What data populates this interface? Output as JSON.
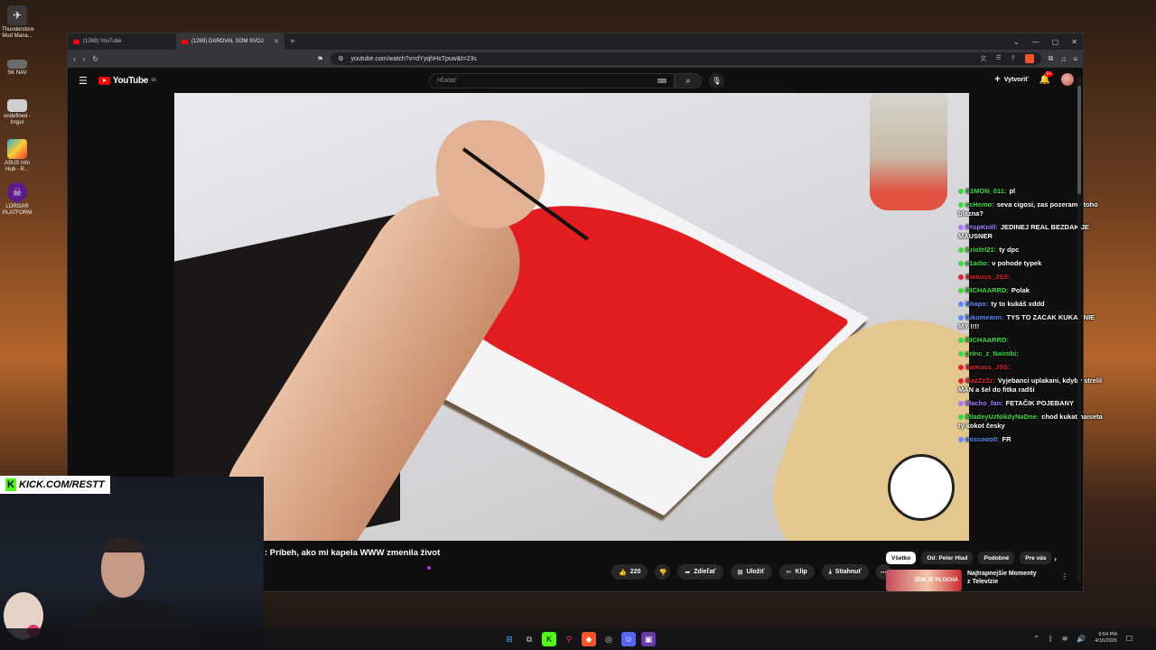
{
  "desktop": {
    "icons": [
      {
        "label": "Thunderstore Mod Mana...",
        "icon": "thunderstore-icon"
      },
      {
        "label": "SK NAV",
        "icon": "folder-icon"
      },
      {
        "label": "undefined - Imgur",
        "icon": "imgur-icon"
      },
      {
        "label": "ASUS Info Hub - R...",
        "icon": "asus-icon"
      },
      {
        "label": "LORGAR PLATFORM",
        "icon": "lorgar-icon"
      }
    ]
  },
  "browser": {
    "tabs": [
      {
        "title": "(1269) YouTube",
        "active": false
      },
      {
        "title": "(1269) DAROVAL SOM SVOJ",
        "active": true
      }
    ],
    "url": "youtube.com/watch?v=dYyqhHxTpuw&t=23s"
  },
  "youtube": {
    "logo_text": "YouTube",
    "logo_region": "SK",
    "search_placeholder": "Hľadať",
    "create_label": "Vytvoriť",
    "notif_count": "9+",
    "video_title": ": Príbeh, ako mi kapela WWW zmenila život",
    "actions": {
      "like_count": "220",
      "share": "Zdieľať",
      "save": "Uložiť",
      "clip": "Klip",
      "download": "Stiahnuť"
    },
    "chips": [
      "Všetko",
      "Od: Peter Hlad",
      "Podobné",
      "Pre vás"
    ],
    "recommended": {
      "thumb_text": "ZEM JE PLOCHÁ",
      "title": "Najtrapnejšie Momenty z Televízie"
    }
  },
  "chat": [
    {
      "user": "S1MON_011:",
      "msg": "pl",
      "color": "#3cdc3c"
    },
    {
      "user": "scHemo:",
      "msg": "seva cigosi, zas pozerame toho blazna?",
      "color": "#3cdc3c"
    },
    {
      "user": "PropKnill:",
      "msg": "JEDINEJ REAL BEZDAK JE MAUSNER",
      "color": "#a87cff"
    },
    {
      "user": "Kristel21:",
      "msg": "ty dpc",
      "color": "#3cdc3c"
    },
    {
      "user": "e1adio:",
      "msg": "v pohode typek",
      "color": "#3cdc3c"
    },
    {
      "user": "Samuss_JSS:",
      "msg": "",
      "color": "#e0262a"
    },
    {
      "user": "RICHAARRD:",
      "msg": "Polak",
      "color": "#3cdc3c"
    },
    {
      "user": "Shapo:",
      "msg": "ty to kukáš xddd",
      "color": "#5a8cff"
    },
    {
      "user": "fukumeann:",
      "msg": "TYS TO ZACAK KUKAT NIE MY !!!!",
      "color": "#5a8cff"
    },
    {
      "user": "RICHAARRD:",
      "msg": "",
      "color": "#3cdc3c"
    },
    {
      "user": "princ_z_Nairobi:",
      "msg": "",
      "color": "#3cdc3c"
    },
    {
      "user": "Samuss_JSS:",
      "msg": "",
      "color": "#e0262a"
    },
    {
      "user": "GazZzZz:",
      "msg": "Vyjebanci uplakani, kdyby strelil MAN a šel do fitka radši",
      "color": "#e0262a"
    },
    {
      "user": "Macho_fan:",
      "msg": "FETAČIK POJEBANY",
      "color": "#a87cff"
    },
    {
      "user": "MladeyUzNikdyNaDne:",
      "msg": "chod kukat haiseta ty kokot česky",
      "color": "#3cdc3c"
    },
    {
      "user": "missooo0:",
      "msg": "FR",
      "color": "#5a8cff"
    }
  ],
  "stream": {
    "kick_url": "KICK.COM/RESTT"
  },
  "taskbar": {
    "time": "9:54 PM",
    "date": "4/16/2026"
  }
}
